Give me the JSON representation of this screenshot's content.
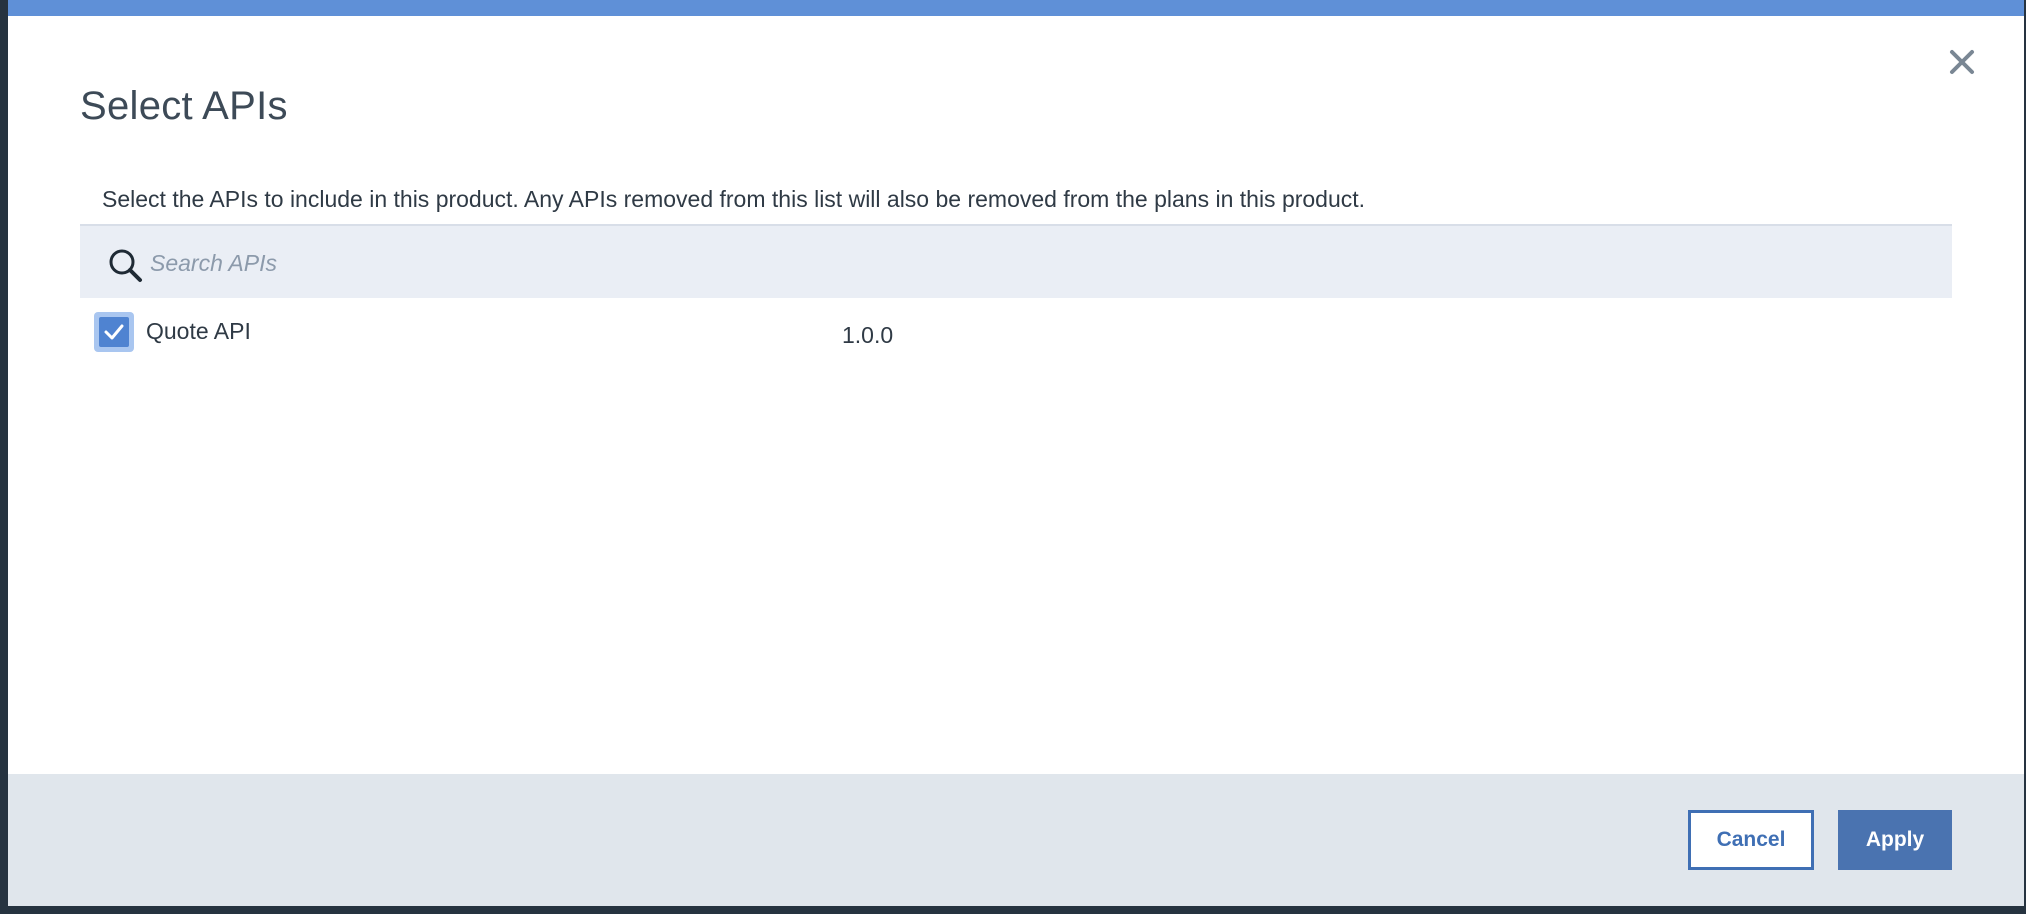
{
  "dialog": {
    "title": "Select APIs",
    "description": "Select the APIs to include in this product. Any APIs removed from this list will also be removed from the plans in this product.",
    "close_icon": "close-icon"
  },
  "search": {
    "placeholder": "Search APIs",
    "value": "",
    "icon": "search-icon"
  },
  "apis": [
    {
      "name": "Quote API",
      "version": "1.0.0",
      "checked": true
    }
  ],
  "footer": {
    "cancel_label": "Cancel",
    "apply_label": "Apply"
  },
  "colors": {
    "accent": "#5f90d7",
    "primary_button": "#4a73b0",
    "checkbox": "#4f83d1",
    "search_bg": "#eaeef5",
    "footer_bg": "#e0e6ec"
  }
}
